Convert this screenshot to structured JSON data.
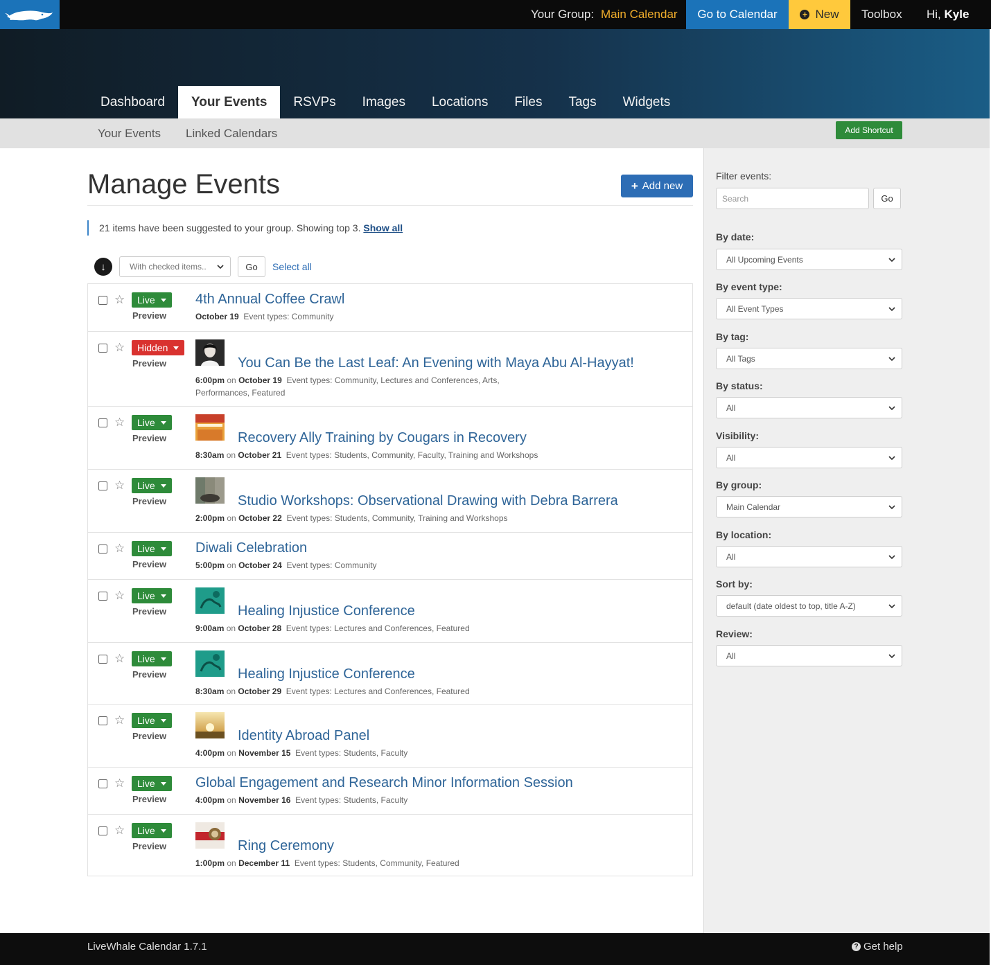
{
  "topbar": {
    "group_label": "Your Group:",
    "group_name": "Main Calendar",
    "go_to_calendar": "Go to Calendar",
    "new_label": "New",
    "toolbox": "Toolbox",
    "greeting": "Hi,",
    "user_name": "Kyle"
  },
  "tabs": [
    "Dashboard",
    "Your Events",
    "RSVPs",
    "Images",
    "Locations",
    "Files",
    "Tags",
    "Widgets"
  ],
  "active_tab": "Your Events",
  "subnav": {
    "items": [
      "Your Events",
      "Linked Calendars"
    ],
    "shortcut": "Add Shortcut"
  },
  "main": {
    "title": "Manage Events",
    "add_new": "Add new",
    "notice": "21 items have been suggested to your group. Showing top 3.",
    "show_all": "Show all",
    "bulk_placeholder": "With checked items..",
    "go": "Go",
    "select_all": "Select all"
  },
  "events": [
    {
      "status": "Live",
      "preview": "Preview",
      "title": "4th Annual Coffee Crawl",
      "time": "",
      "date": "October 19",
      "types_label": "Event types:",
      "types": "Community",
      "thumb": ""
    },
    {
      "status": "Hidden",
      "preview": "Preview",
      "title": "You Can Be the Last Leaf: An Evening with Maya Abu Al-Hayyat!",
      "time": "6:00pm",
      "date": "October 19",
      "types_label": "Event types:",
      "types": "Community, Lectures and Conferences, Arts,",
      "types2": "Performances, Featured",
      "thumb": "portrait"
    },
    {
      "status": "Live",
      "preview": "Preview",
      "title": "Recovery Ally Training by Cougars in Recovery",
      "time": "8:30am",
      "date": "October 21",
      "types_label": "Event types:",
      "types": "Students, Community, Faculty, Training and Workshops",
      "thumb": "poster"
    },
    {
      "status": "Live",
      "preview": "Preview",
      "title": "Studio Workshops: Observational Drawing with Debra Barrera",
      "time": "2:00pm",
      "date": "October 22",
      "types_label": "Event types:",
      "types": "Students, Community, Training and Workshops",
      "thumb": "studio"
    },
    {
      "status": "Live",
      "preview": "Preview",
      "title": "Diwali Celebration",
      "time": "5:00pm",
      "date": "October 24",
      "types_label": "Event types:",
      "types": "Community",
      "thumb": ""
    },
    {
      "status": "Live",
      "preview": "Preview",
      "title": "Healing Injustice Conference",
      "time": "9:00am",
      "date": "October 28",
      "types_label": "Event types:",
      "types": "Lectures and Conferences, Featured",
      "thumb": "teal"
    },
    {
      "status": "Live",
      "preview": "Preview",
      "title": "Healing Injustice Conference",
      "time": "8:30am",
      "date": "October 29",
      "types_label": "Event types:",
      "types": "Lectures and Conferences, Featured",
      "thumb": "teal"
    },
    {
      "status": "Live",
      "preview": "Preview",
      "title": "Identity Abroad Panel",
      "time": "4:00pm",
      "date": "November 15",
      "types_label": "Event types:",
      "types": "Students, Faculty",
      "thumb": "sunset"
    },
    {
      "status": "Live",
      "preview": "Preview",
      "title": "Global Engagement and Research Minor Information Session",
      "time": "4:00pm",
      "date": "November 16",
      "types_label": "Event types:",
      "types": "Students, Faculty",
      "thumb": ""
    },
    {
      "status": "Live",
      "preview": "Preview",
      "title": "Ring Ceremony",
      "time": "1:00pm",
      "date": "December 11",
      "types_label": "Event types:",
      "types": "Students, Community, Featured",
      "thumb": "ring"
    }
  ],
  "on_word": "on",
  "sidebar": {
    "filter_label": "Filter events:",
    "search_placeholder": "Search",
    "go": "Go",
    "filters": [
      {
        "label": "By date:",
        "value": "All Upcoming Events"
      },
      {
        "label": "By event type:",
        "value": "All Event Types"
      },
      {
        "label": "By tag:",
        "value": "All Tags"
      },
      {
        "label": "By status:",
        "value": "All"
      },
      {
        "label": "Visibility:",
        "value": "All"
      },
      {
        "label": "By group:",
        "value": "Main Calendar"
      },
      {
        "label": "By location:",
        "value": "All"
      },
      {
        "label": "Sort by:",
        "value": "default (date oldest to top, title A-Z)"
      },
      {
        "label": "Review:",
        "value": "All"
      }
    ]
  },
  "footer": {
    "version": "LiveWhale Calendar 1.7.1",
    "help": "Get help"
  },
  "colors": {
    "primary": "#1b73b9",
    "new_button": "#ffc93c",
    "live": "#2e8b3a",
    "hidden": "#d9322f",
    "link": "#2f6598"
  }
}
